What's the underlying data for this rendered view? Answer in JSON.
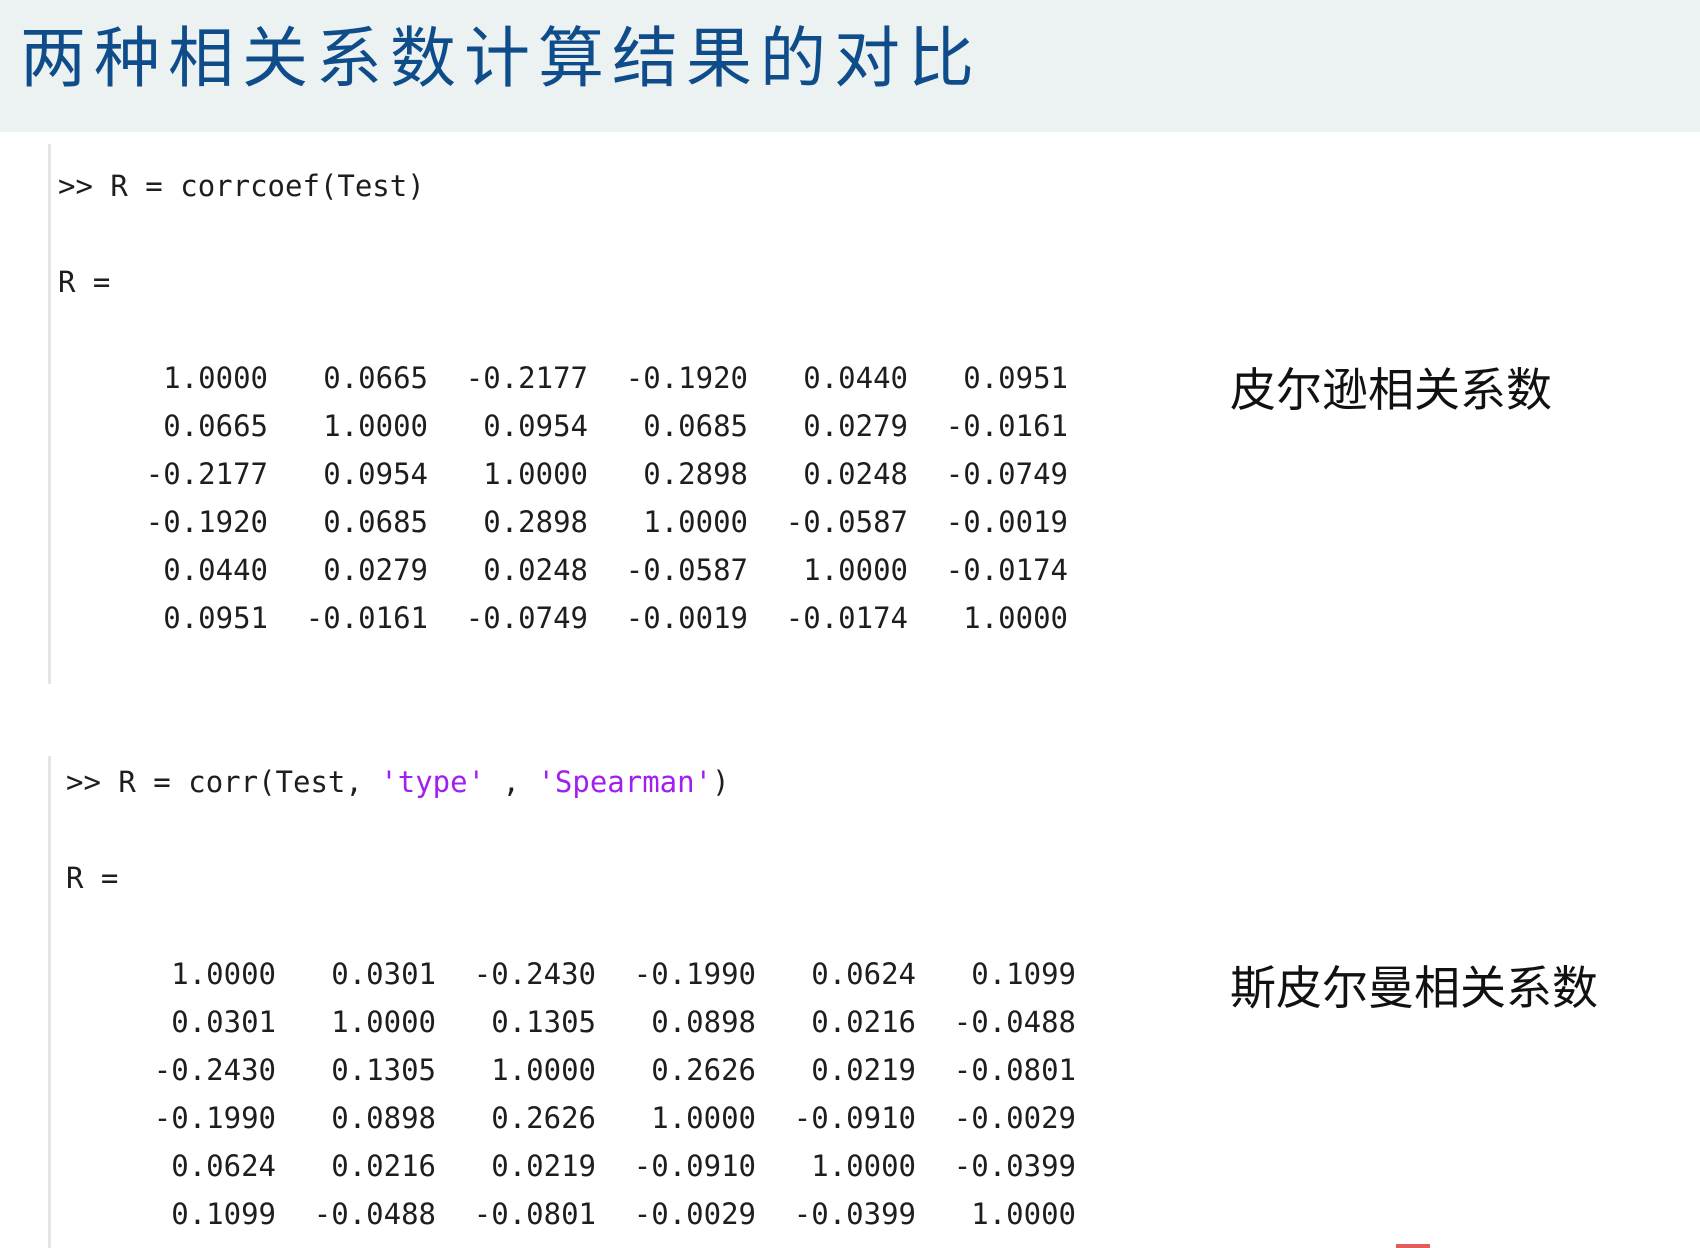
{
  "title": "两种相关系数计算结果的对比",
  "pearson": {
    "prompt": ">>",
    "command_prefix": "R = corrcoef(Test)",
    "result_label": "R =",
    "caption": "皮尔逊相关系数",
    "matrix": [
      [
        "1.0000",
        "0.0665",
        "-0.2177",
        "-0.1920",
        "0.0440",
        "0.0951"
      ],
      [
        "0.0665",
        "1.0000",
        "0.0954",
        "0.0685",
        "0.0279",
        "-0.0161"
      ],
      [
        "-0.2177",
        "0.0954",
        "1.0000",
        "0.2898",
        "0.0248",
        "-0.0749"
      ],
      [
        "-0.1920",
        "0.0685",
        "0.2898",
        "1.0000",
        "-0.0587",
        "-0.0019"
      ],
      [
        "0.0440",
        "0.0279",
        "0.0248",
        "-0.0587",
        "1.0000",
        "-0.0174"
      ],
      [
        "0.0951",
        "-0.0161",
        "-0.0749",
        "-0.0019",
        "-0.0174",
        "1.0000"
      ]
    ]
  },
  "spearman": {
    "prompt": ">>",
    "command_prefix": "R = corr(Test, ",
    "arg_type": "'type'",
    "separator": " , ",
    "arg_method": "'Spearman'",
    "command_suffix": ")",
    "result_label": "R =",
    "caption": "斯皮尔曼相关系数",
    "matrix": [
      [
        "1.0000",
        "0.0301",
        "-0.2430",
        "-0.1990",
        "0.0624",
        "0.1099"
      ],
      [
        "0.0301",
        "1.0000",
        "0.1305",
        "0.0898",
        "0.0216",
        "-0.0488"
      ],
      [
        "-0.2430",
        "0.1305",
        "1.0000",
        "0.2626",
        "0.0219",
        "-0.0801"
      ],
      [
        "-0.1990",
        "0.0898",
        "0.2626",
        "1.0000",
        "-0.0910",
        "-0.0029"
      ],
      [
        "0.0624",
        "0.0216",
        "0.0219",
        "-0.0910",
        "1.0000",
        "-0.0399"
      ],
      [
        "0.1099",
        "-0.0488",
        "-0.0801",
        "-0.0029",
        "-0.0399",
        "1.0000"
      ]
    ]
  },
  "colors": {
    "title": "#0f4d8a",
    "title_background": "#ecf1f2",
    "string_literal": "#a020f0",
    "console_text": "#1e1e1e"
  }
}
